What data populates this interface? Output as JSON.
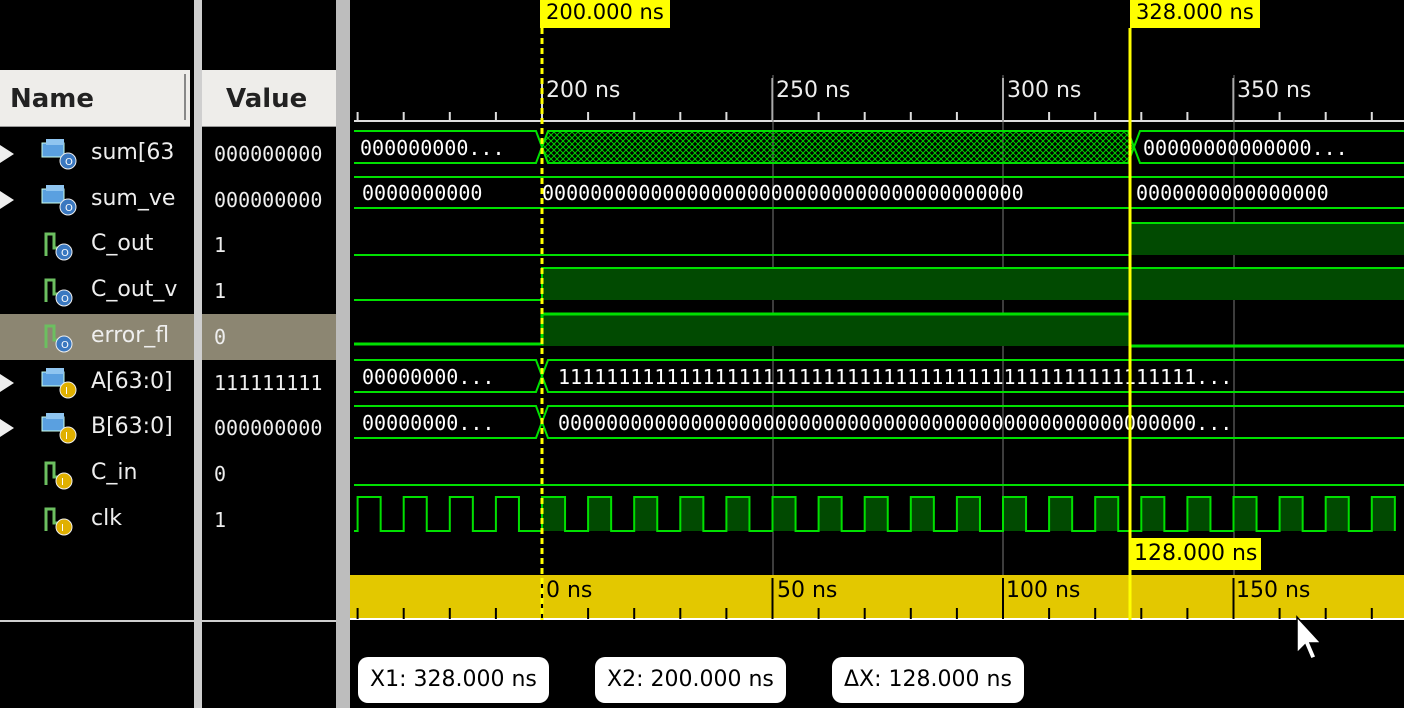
{
  "panes": {
    "name_header": "Name",
    "value_header": "Value"
  },
  "signals": [
    {
      "name": "sum[63",
      "value": "000000000",
      "type": "bus",
      "icon": "bus-output-icon",
      "expandable": true
    },
    {
      "name": "sum_ve",
      "value": "000000000",
      "type": "bus",
      "icon": "bus-output-icon",
      "expandable": true
    },
    {
      "name": "C_out",
      "value": "1",
      "type": "bit",
      "icon": "bit-output-icon",
      "expandable": false
    },
    {
      "name": "C_out_v",
      "value": "1",
      "type": "bit",
      "icon": "bit-output-icon",
      "expandable": false
    },
    {
      "name": "error_fl",
      "value": "0",
      "type": "bit",
      "icon": "bit-output-icon",
      "expandable": false,
      "selected": true
    },
    {
      "name": "A[63:0]",
      "value": "111111111",
      "type": "bus",
      "icon": "bus-input-icon",
      "expandable": true
    },
    {
      "name": "B[63:0]",
      "value": "000000000",
      "type": "bus",
      "icon": "bus-input-icon",
      "expandable": true
    },
    {
      "name": "C_in",
      "value": "0",
      "type": "bit",
      "icon": "bit-input-icon",
      "expandable": false
    },
    {
      "name": "clk",
      "value": "1",
      "type": "bit",
      "icon": "bit-input-icon",
      "expandable": false
    }
  ],
  "markers": {
    "cursor_a_label": "200.000 ns",
    "cursor_b_label": "328.000 ns",
    "delta_label": "128.000 ns"
  },
  "time_ruler": {
    "labels": [
      "200 ns",
      "250 ns",
      "300 ns",
      "350 ns"
    ]
  },
  "relative_ruler": {
    "labels": [
      "0 ns",
      "50 ns",
      "100 ns",
      "150 ns"
    ]
  },
  "bus_values": {
    "sum_before": "000000000...",
    "sum_after": "00000000000000...",
    "sum_ve_before": "0000000000",
    "sum_ve_mid": "0000000000000000000000000000000000000000",
    "sum_ve_after": "0000000000000000",
    "a_before": "00000000...",
    "a_after": "11111111111111111111111111111111111111111111111111111...",
    "b_before": "00000000...",
    "b_after": "00000000000000000000000000000000000000000000000000000..."
  },
  "readouts": {
    "x1": "X1: 328.000 ns",
    "x2": "X2: 200.000 ns",
    "dx": "ΔX: 128.000 ns"
  },
  "colors": {
    "wave_green": "#00e000",
    "wave_fill": "#014a01",
    "marker_yellow": "#ffff00",
    "ruler_gold": "#e3c800"
  }
}
